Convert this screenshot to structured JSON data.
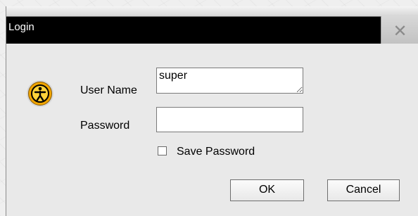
{
  "window": {
    "title": "Login",
    "close_glyph": "✕"
  },
  "icon": {
    "name": "accessibility-icon",
    "colors": [
      "#f0a500",
      "#000000"
    ]
  },
  "form": {
    "username_label": "User Name",
    "username_value": "super",
    "password_label": "Password",
    "password_value": "",
    "save_password_label": "Save Password",
    "save_password_checked": false
  },
  "buttons": {
    "ok_label": "OK",
    "cancel_label": "Cancel"
  }
}
